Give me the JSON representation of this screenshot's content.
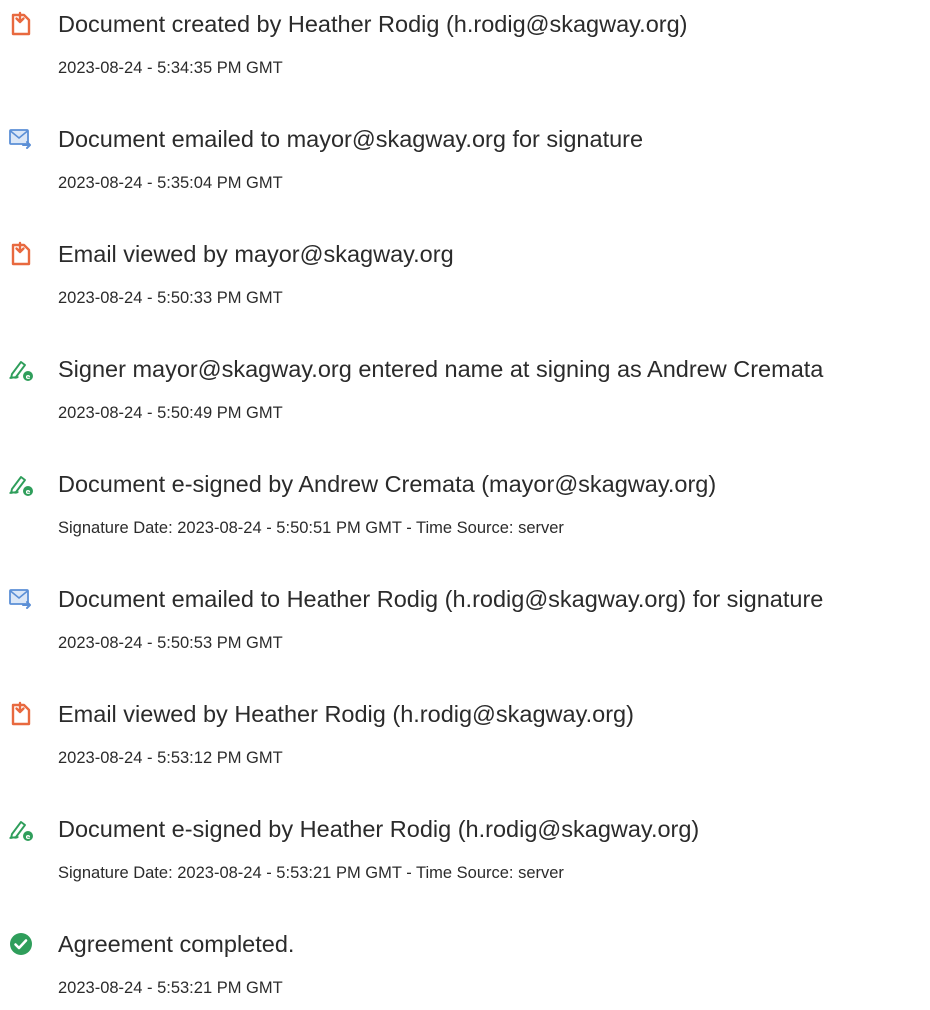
{
  "events": [
    {
      "icon": "document-created-icon",
      "title": "Document created by Heather Rodig (h.rodig@skagway.org)",
      "time": "2023-08-24 - 5:34:35 PM GMT"
    },
    {
      "icon": "email-sent-icon",
      "title": "Document emailed to mayor@skagway.org for signature",
      "time": "2023-08-24 - 5:35:04 PM GMT"
    },
    {
      "icon": "document-viewed-icon",
      "title": "Email viewed by mayor@skagway.org",
      "time": "2023-08-24 - 5:50:33 PM GMT"
    },
    {
      "icon": "e-sign-pen-icon",
      "title": "Signer mayor@skagway.org entered name at signing as Andrew Cremata",
      "time": "2023-08-24 - 5:50:49 PM GMT"
    },
    {
      "icon": "e-sign-pen-icon",
      "title": "Document e-signed by Andrew Cremata (mayor@skagway.org)",
      "time": "Signature Date: 2023-08-24 - 5:50:51 PM GMT - Time Source: server"
    },
    {
      "icon": "email-sent-icon",
      "title": "Document emailed to Heather Rodig (h.rodig@skagway.org) for signature",
      "time": "2023-08-24 - 5:50:53 PM GMT"
    },
    {
      "icon": "document-viewed-icon",
      "title": "Email viewed by Heather Rodig (h.rodig@skagway.org)",
      "time": "2023-08-24 - 5:53:12 PM GMT"
    },
    {
      "icon": "e-sign-pen-icon",
      "title": "Document e-signed by Heather Rodig (h.rodig@skagway.org)",
      "time": "Signature Date: 2023-08-24 - 5:53:21 PM GMT - Time Source: server"
    },
    {
      "icon": "check-circle-icon",
      "title": "Agreement completed.",
      "time": "2023-08-24 - 5:53:21 PM GMT"
    }
  ],
  "colors": {
    "document_icon": "#e8693f",
    "email_icon": "#5b8fd6",
    "pen_icon": "#2f9e5b",
    "check_icon": "#2f9e5b",
    "text": "#2b2b2b"
  }
}
